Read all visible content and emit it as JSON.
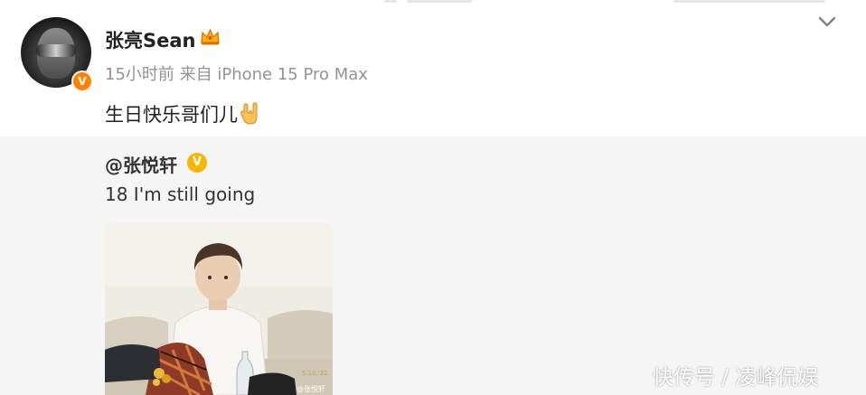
{
  "post": {
    "author_name": "张亮Sean",
    "verified_mark": "V",
    "time": "15小时前",
    "source": "来自 iPhone 15 Pro Max",
    "text": "生日快乐哥们儿",
    "emoji_icon": "rock-hand-icon",
    "menu_icon": "chevron-down-icon"
  },
  "repost": {
    "author": "@张悦轩",
    "verified_mark": "V",
    "text": "18 I'm still going",
    "image_caption_stamp": "5.10.'22",
    "image_credit": "@张悦轩"
  },
  "watermark": "快传号 / 凌峰侃娱",
  "colors": {
    "accent_orange": "#ff8200",
    "verified_yellow": "#f9b600",
    "repost_bg": "#f5f5f5",
    "meta_gray": "#939393"
  }
}
